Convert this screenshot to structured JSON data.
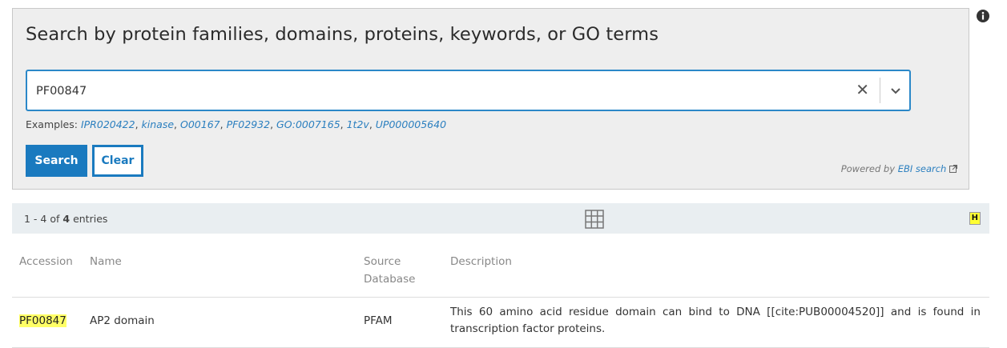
{
  "search": {
    "title": "Search by protein families, domains, proteins, keywords, or GO terms",
    "query": "PF00847",
    "examples_label": "Examples:",
    "examples": [
      "IPR020422",
      "kinase",
      "O00167",
      "PF02932",
      "GO:0007165",
      "1t2v",
      "UP000005640"
    ],
    "search_button": "Search",
    "clear_button": "Clear",
    "powered_by": "Powered by",
    "powered_link": "EBI search"
  },
  "results": {
    "range": "1 - 4 of",
    "total": "4",
    "unit": "entries",
    "highlight_toggle": "H"
  },
  "table": {
    "headers": {
      "accession": "Accession",
      "name": "Name",
      "source": "Source Database",
      "description": "Description"
    },
    "rows": [
      {
        "accession": "PF00847",
        "name": "AP2 domain",
        "source": "PFAM",
        "description": "This 60 amino acid residue domain can bind to DNA [[cite:PUB00004520]] and is found in transcription factor proteins."
      }
    ]
  },
  "colors": {
    "accent": "#1a7abf",
    "highlight": "#ffff66",
    "panel": "#eeeeee"
  }
}
